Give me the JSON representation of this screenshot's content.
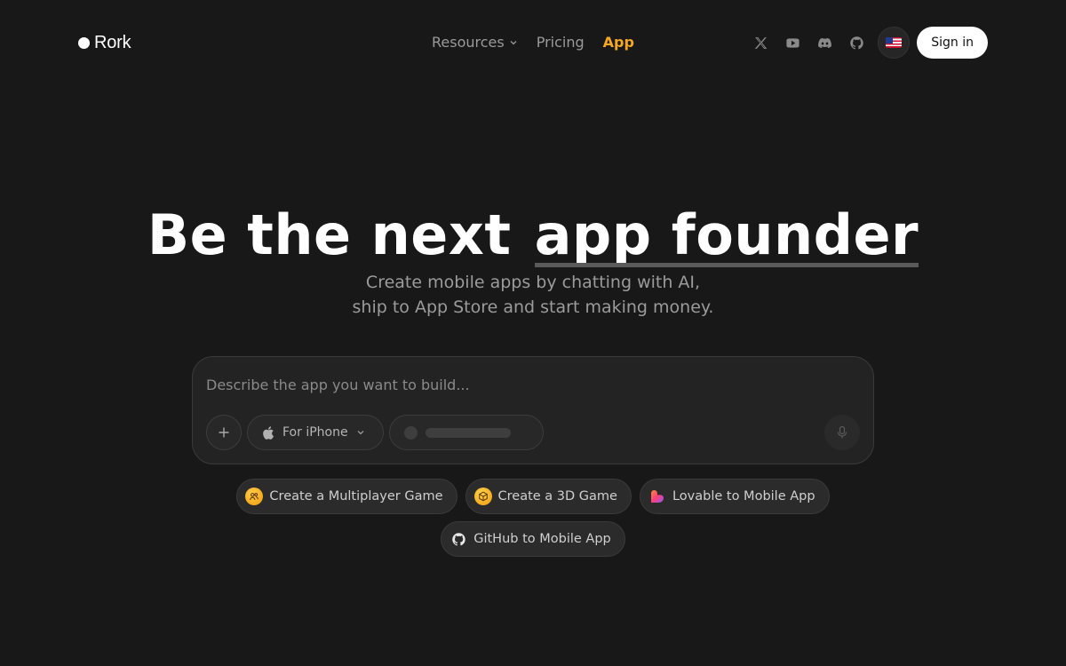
{
  "brand": {
    "name": "Rork"
  },
  "nav": {
    "items": [
      {
        "label": "Resources",
        "has_dropdown": true
      },
      {
        "label": "Pricing"
      },
      {
        "label": "App",
        "active": true
      }
    ]
  },
  "header_icons": [
    "x-icon",
    "youtube-icon",
    "discord-icon",
    "github-icon"
  ],
  "language": {
    "flag": "us-flag-icon"
  },
  "signin_label": "Sign in",
  "hero": {
    "title_lead": "Be the next",
    "title_highlight": "app founder",
    "subtitle_line1": "Create mobile apps by chatting with AI,",
    "subtitle_line2": "ship to App Store and start making money."
  },
  "prompt": {
    "placeholder": "Describe the app you want to build...",
    "value": "",
    "platform_label": "For iPhone"
  },
  "suggestions": [
    {
      "label": "Create a Multiplayer Game",
      "icon": "multiplayer-icon"
    },
    {
      "label": "Create a 3D Game",
      "icon": "cube-icon"
    },
    {
      "label": "Lovable to Mobile App",
      "icon": "lovable-heart-icon"
    },
    {
      "label": "GitHub to Mobile App",
      "icon": "github-icon"
    }
  ],
  "colors": {
    "background": "#181818",
    "accent": "#f5a623",
    "nav_text": "#9a9a9a"
  }
}
